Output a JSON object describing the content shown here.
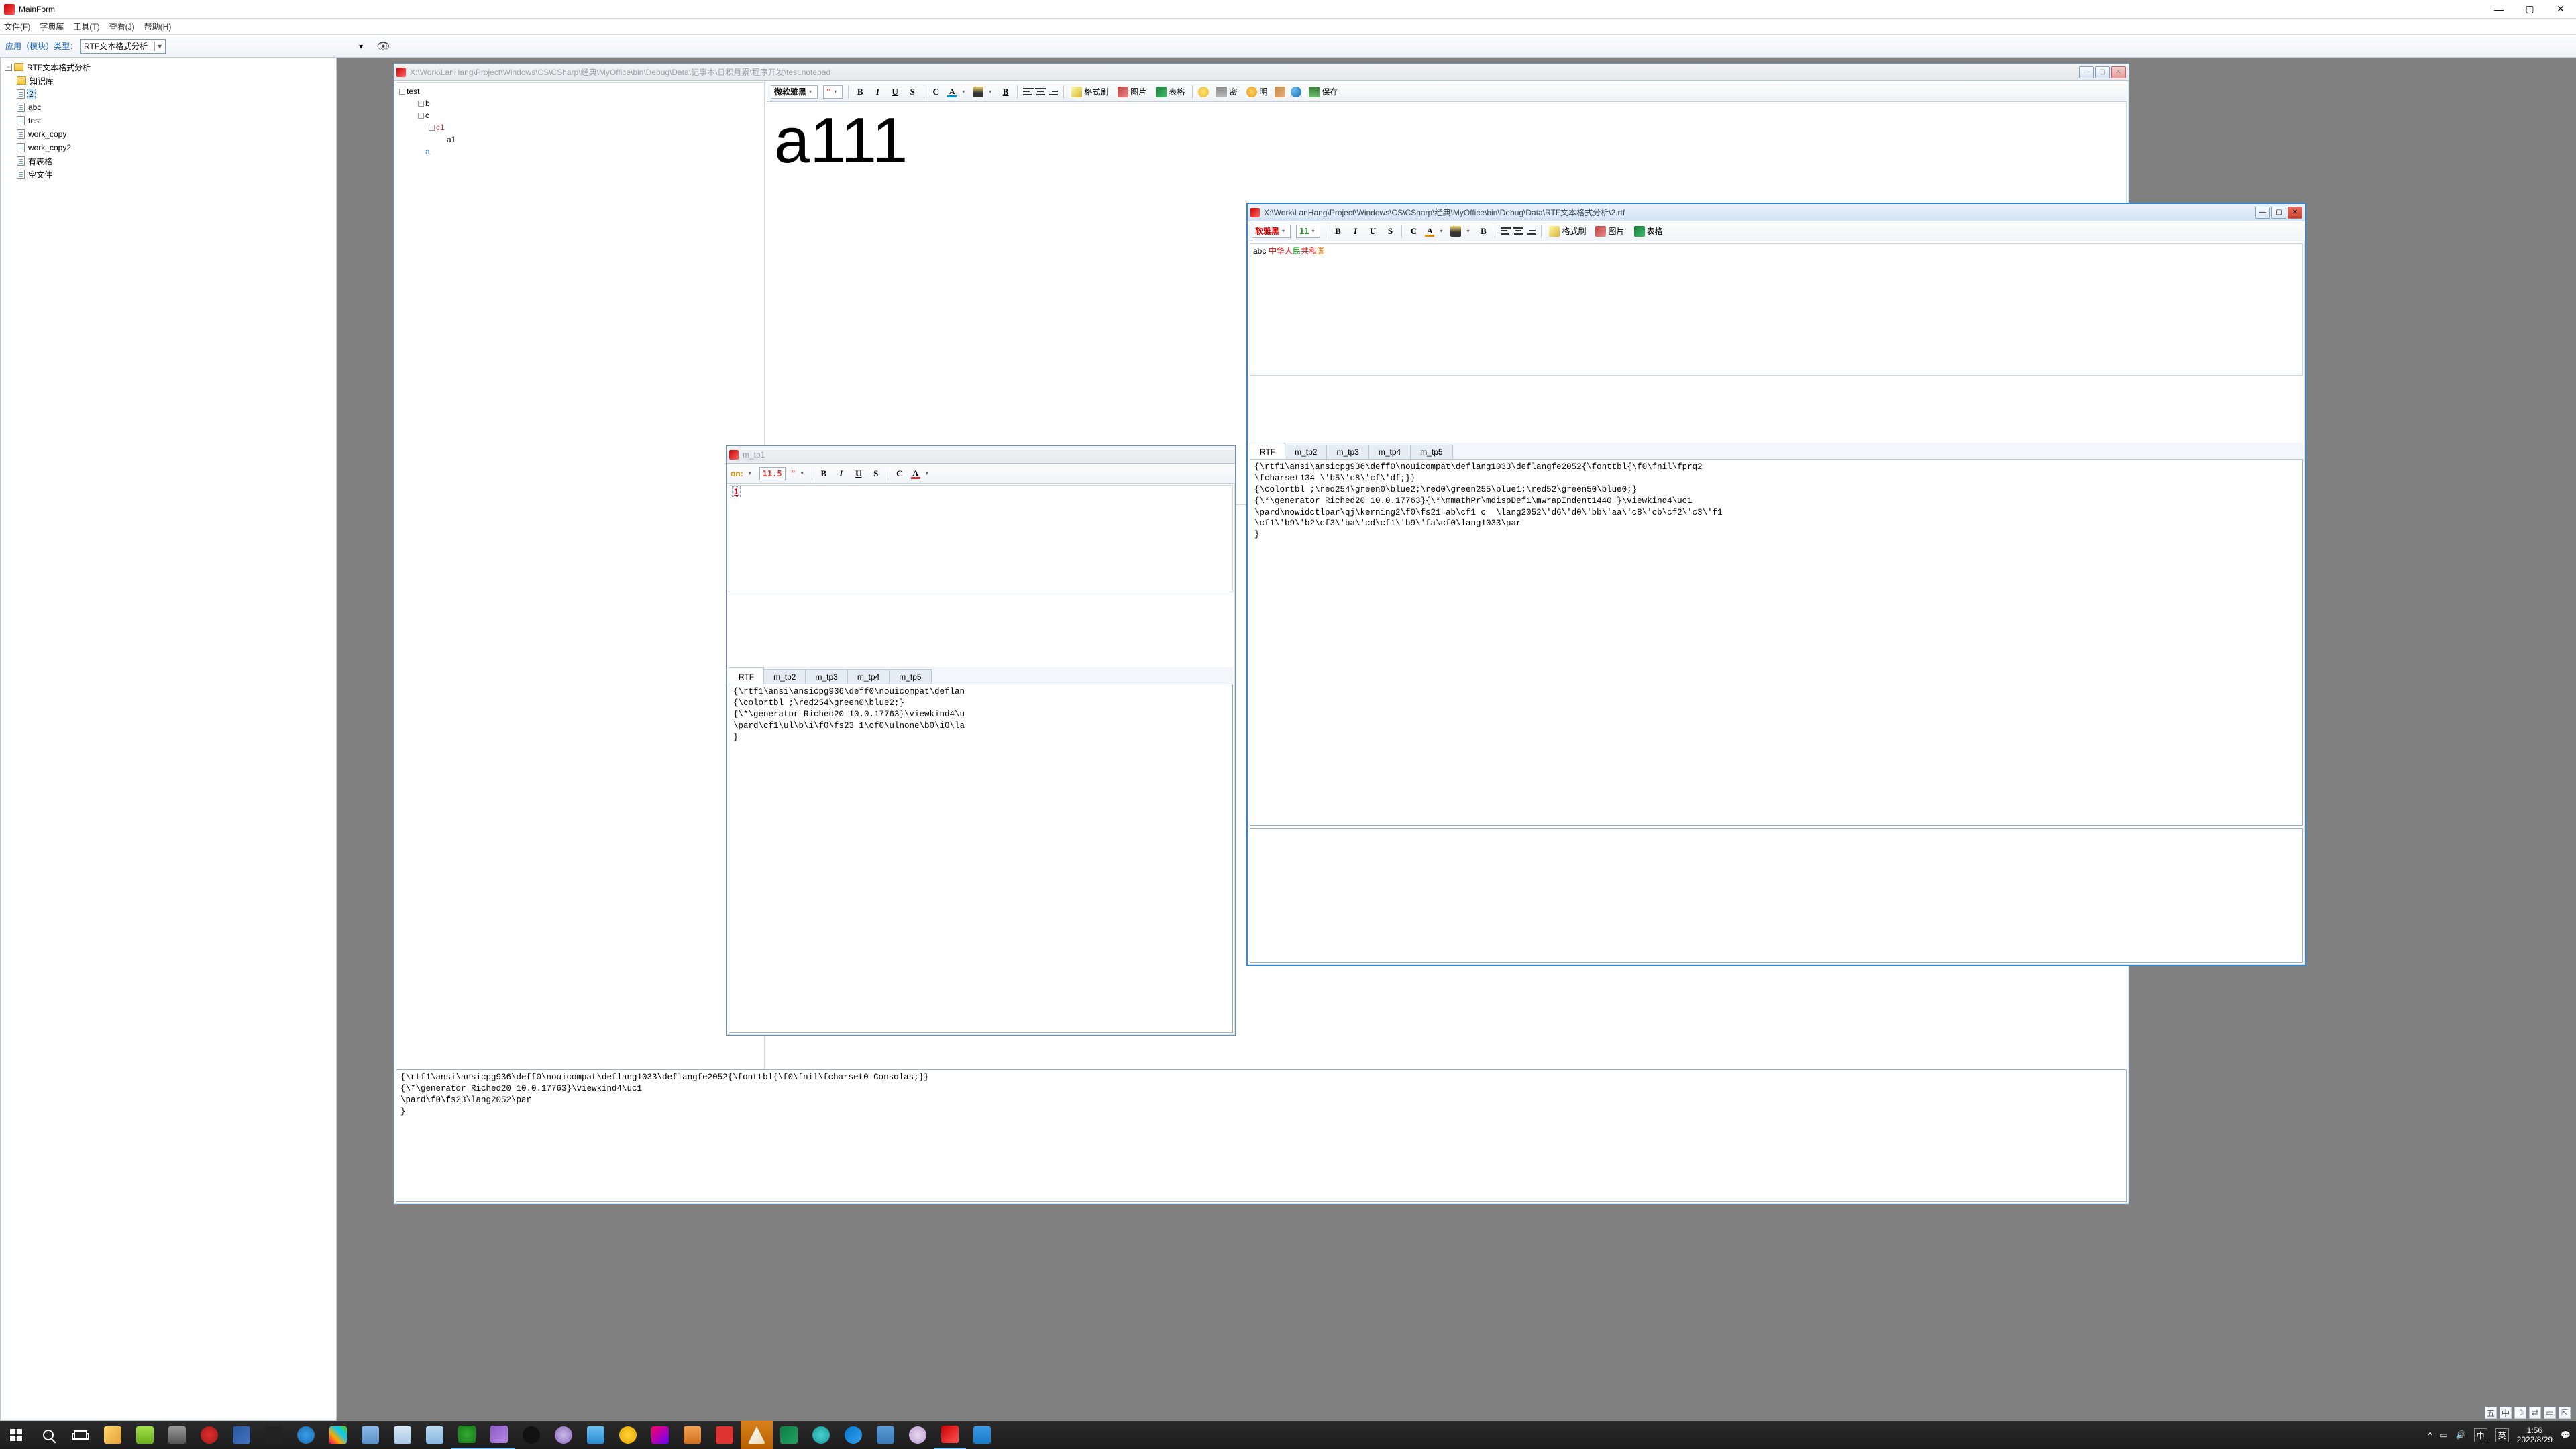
{
  "app": {
    "title": "MainForm",
    "min": "—",
    "max": "▢",
    "close": "✕"
  },
  "menu": {
    "file": "文件(F)",
    "fontlib": "字典库",
    "tools": "工具(T)",
    "view": "查看(J)",
    "help": "帮助(H)"
  },
  "toolbar": {
    "module_label": "应用（模块）类型：",
    "module_value": "RTF文本格式分析"
  },
  "left_tree": {
    "root": "RTF文本格式分析",
    "items": [
      {
        "label": "知识库",
        "type": "folder"
      },
      {
        "label": "2",
        "type": "file",
        "selected": true
      },
      {
        "label": "abc",
        "type": "file"
      },
      {
        "label": "test",
        "type": "file"
      },
      {
        "label": "work_copy",
        "type": "file"
      },
      {
        "label": "work_copy2",
        "type": "file"
      },
      {
        "label": "有表格",
        "type": "file"
      },
      {
        "label": "空文件",
        "type": "file"
      }
    ]
  },
  "win1": {
    "title": "X:\\Work\\LanHang\\Project\\Windows\\CS\\CSharp\\经典\\MyOffice\\bin\\Debug\\Data\\记事本\\日积月累\\程序开发\\test.notepad",
    "font_name": "微软雅黑",
    "font_quote": "\"",
    "btn_format": "格式刷",
    "btn_image": "图片",
    "btn_table": "表格",
    "btn_lock": "密",
    "btn_sun": "明",
    "btn_save": "保存",
    "a111": "a111",
    "tree": {
      "root": "test",
      "b": "b",
      "c": "c",
      "c1": "c1",
      "a1": "a1",
      "a": "a"
    },
    "bottom_rtf": "{\\rtf1\\ansi\\ansicpg936\\deff0\\nouicompat\\deflang1033\\deflangfe2052{\\fonttbl{\\f0\\fnil\\fcharset0 Consolas;}}\n{\\*\\generator Riched20 10.0.17763}\\viewkind4\\uc1\n\\pard\\f0\\fs23\\lang2052\\par\n}"
  },
  "win2": {
    "title": "m_tp1",
    "on_label": "on:",
    "font_size": "11.5",
    "font_quote": "\"",
    "one": "1",
    "tabs": {
      "rtf": "RTF",
      "t2": "m_tp2",
      "t3": "m_tp3",
      "t4": "m_tp4",
      "t5": "m_tp5"
    },
    "code": "{\\rtf1\\ansi\\ansicpg936\\deff0\\nouicompat\\deflan\n{\\colortbl ;\\red254\\green0\\blue2;}\n{\\*\\generator Riched20 10.0.17763}\\viewkind4\\u\n\\pard\\cf1\\ul\\b\\i\\f0\\fs23 1\\cf0\\ulnone\\b0\\i0\\la\n}"
  },
  "win3": {
    "title": "X:\\Work\\LanHang\\Project\\Windows\\CS\\CSharp\\经典\\MyOffice\\bin\\Debug\\Data\\RTF文本格式分析\\2.rtf",
    "font_name": "软雅黑",
    "font_size": "11",
    "btn_format": "格式刷",
    "btn_image": "图片",
    "btn_table": "表格",
    "line_abc": "abc",
    "line_zh1": "中华人",
    "line_zh2": "民",
    "line_zh3": "共和",
    "line_zh4": "国",
    "tabs": {
      "rtf": "RTF",
      "t2": "m_tp2",
      "t3": "m_tp3",
      "t4": "m_tp4",
      "t5": "m_tp5"
    },
    "code": "{\\rtf1\\ansi\\ansicpg936\\deff0\\nouicompat\\deflang1033\\deflangfe2052{\\fonttbl{\\f0\\fnil\\fprq2\n\\fcharset134 \\'b5\\'c8\\'cf\\'df;}}\n{\\colortbl ;\\red254\\green0\\blue2;\\red0\\green255\\blue1;\\red52\\green50\\blue0;}\n{\\*\\generator Riched20 10.0.17763}{\\*\\mmathPr\\mdispDef1\\mwrapIndent1440 }\\viewkind4\\uc1\n\\pard\\nowidctlpar\\qj\\kerning2\\f0\\fs21 ab\\cf1 c  \\lang2052\\'d6\\'d0\\'bb\\'aa\\'c8\\'cb\\cf2\\'c3\\'f1\n\\cf1\\'b9\\'b2\\cf3\\'ba\\'cd\\cf1\\'b9\\'fa\\cf0\\lang1033\\par\n}"
  },
  "labels": {
    "B": "B",
    "I": "I",
    "U": "U",
    "S": "S",
    "C": "C",
    "A": "A"
  },
  "status": {
    "s1": "五",
    "s2": "中",
    "moon": "☽",
    "s4": "⇄",
    "s5": "▭",
    "s6": "⇱"
  },
  "tray": {
    "caret": "^",
    "time": "1:56",
    "date": "2022/8/29",
    "ime1": "中",
    "ime2": "英"
  }
}
